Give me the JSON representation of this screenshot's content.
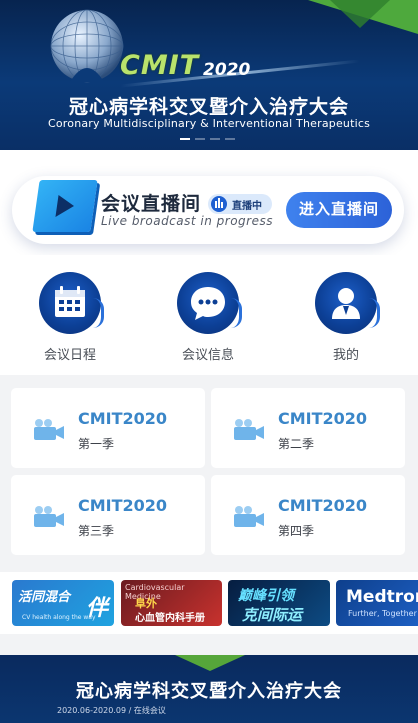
{
  "banner": {
    "brand": "CMIT",
    "brand_year": "2020",
    "title_cn": "冠心病学科交叉暨介入治疗大会",
    "title_en": "Coronary Multidisciplinary & Interventional Therapeutics",
    "carousel_active": 1,
    "carousel_count": 4
  },
  "live": {
    "title": "会议直播间",
    "subtitle": "Live broadcast in progress",
    "badge": "直播中",
    "enter_label": "进入直播间"
  },
  "menu": [
    {
      "label": "会议日程",
      "icon": "calendar-icon"
    },
    {
      "label": "会议信息",
      "icon": "chat-bubble-icon"
    },
    {
      "label": "我的",
      "icon": "user-icon"
    }
  ],
  "seasons": [
    {
      "title": "CMIT2020",
      "sub": "第一季",
      "icon": "video-camera-icon"
    },
    {
      "title": "CMIT2020",
      "sub": "第二季",
      "icon": "video-camera-icon"
    },
    {
      "title": "CMIT2020",
      "sub": "第三季",
      "icon": "video-camera-icon"
    },
    {
      "title": "CMIT2020",
      "sub": "第四季",
      "icon": "video-camera-icon"
    }
  ],
  "sponsors": [
    {
      "line1": "活同混合",
      "line2": "伴",
      "line3": "CV health along the way"
    },
    {
      "line1": "Cardiovascular Medicine",
      "line2": "阜外",
      "line3": "心血管内科手册"
    },
    {
      "line1": "巅峰引领",
      "line2": "克间际运"
    },
    {
      "line1": "Medtron",
      "line2": "Further, Together"
    }
  ],
  "footer": {
    "title": "冠心病学科交叉暨介入治疗大会",
    "meta": "2020.06-2020.09  /  在线会议"
  },
  "colors": {
    "banner_bg": "#0b3a78",
    "accent_green": "#4ea93d",
    "brand_blue": "#2c62d8",
    "season_title": "#3a86c8"
  }
}
